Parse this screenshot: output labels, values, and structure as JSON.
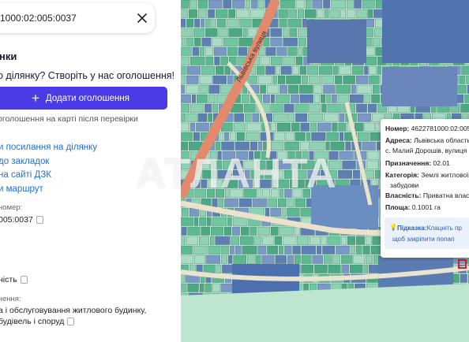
{
  "search": {
    "value": "1000:02:005:0037"
  },
  "panel": {
    "section_title": "нки",
    "promo_text": "о ділянку? Створіть у нас оголошення!",
    "add_button_label": "Додати оголошення",
    "note_text": "оголошення на карті після перевірки",
    "links": {
      "share": "и посилання на ділянку",
      "bookmarks": "до закладок",
      "dzk": "на сайті ДЗК",
      "route": "и маршрут"
    },
    "number_label": "номер:",
    "number_value": "005:0037",
    "ownership_value": "ність",
    "purpose_label": "чення:",
    "purpose_line1": "а і обслуговування житлового будинку,",
    "purpose_line2": "будівель і споруд"
  },
  "map": {
    "street_label": "Львівська вулиця",
    "popup": {
      "number_label": "Номер:",
      "number_value": "4622781000:02:005",
      "address_label": "Адреса:",
      "address_value_1": "Львівська область",
      "address_value_2": "с. Малий Дорошів, вулиця І",
      "purpose_label": "Призначення:",
      "purpose_value": "02.01",
      "category_label": "Категорія:",
      "category_value_1": "Землі житлової",
      "category_value_2": "забудови",
      "ownership_label": "Власність:",
      "ownership_value": "Приватна влас",
      "area_label": "Площа:",
      "area_value": "0.1001 га",
      "hint_label": "Підказка:",
      "hint_text_1": "Клацніть пр",
      "hint_text_2": "щоб закріпити попап"
    },
    "watermark": "АТЛАНТА",
    "colors": {
      "parcel_blue": "#5d7fb4",
      "parcel_green": "#5cb891",
      "road": "#e0866a"
    }
  }
}
